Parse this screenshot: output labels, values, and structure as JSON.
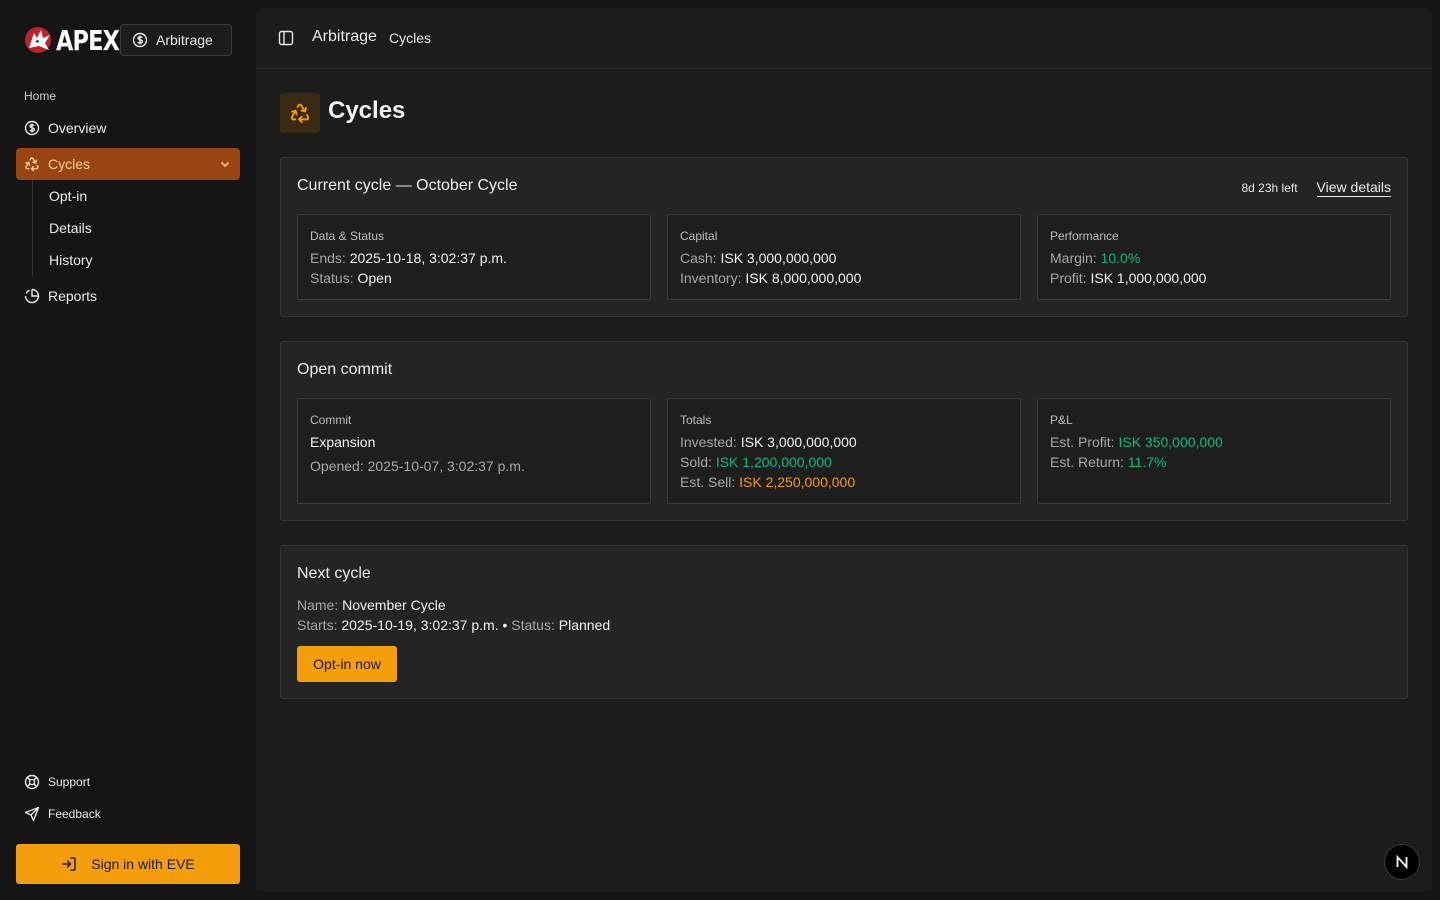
{
  "brand": {
    "logo_text": "APEX",
    "workspace_label": "Arbitrage"
  },
  "sidebar": {
    "group_label": "Home",
    "items": [
      {
        "label": "Overview",
        "icon": "dollar-circle-icon"
      },
      {
        "label": "Cycles",
        "icon": "recycle-icon",
        "active": true
      },
      {
        "label": "Reports",
        "icon": "pie-chart-icon"
      }
    ],
    "subitems": [
      {
        "label": "Opt-in"
      },
      {
        "label": "Details"
      },
      {
        "label": "History"
      }
    ],
    "footer": [
      {
        "label": "Support",
        "icon": "life-buoy-icon"
      },
      {
        "label": "Feedback",
        "icon": "send-icon"
      }
    ],
    "signin_label": "Sign in with EVE"
  },
  "header": {
    "crumb_section": "Arbitrage",
    "crumb_page": "Cycles"
  },
  "page": {
    "title": "Cycles"
  },
  "current_cycle": {
    "title": "Current cycle — October Cycle",
    "time_left": "8d 23h left",
    "view_details": "View details",
    "data_status": {
      "label": "Data & Status",
      "ends_key": "Ends:",
      "ends_val": "2025-10-18, 3:02:37 p.m.",
      "status_key": "Status:",
      "status_val": "Open"
    },
    "capital": {
      "label": "Capital",
      "cash_key": "Cash:",
      "cash_val": "ISK 3,000,000,000",
      "inv_key": "Inventory:",
      "inv_val": "ISK 8,000,000,000"
    },
    "performance": {
      "label": "Performance",
      "margin_key": "Margin:",
      "margin_val": "10.0%",
      "profit_key": "Profit:",
      "profit_val": "ISK 1,000,000,000"
    }
  },
  "open_commit": {
    "title": "Open commit",
    "commit": {
      "label": "Commit",
      "name": "Expansion",
      "opened_key": "Opened:",
      "opened_val": "2025-10-07, 3:02:37 p.m."
    },
    "totals": {
      "label": "Totals",
      "invested_key": "Invested:",
      "invested_val": "ISK 3,000,000,000",
      "sold_key": "Sold:",
      "sold_val": "ISK 1,200,000,000",
      "sell_key": "Est. Sell:",
      "sell_val": "ISK 2,250,000,000"
    },
    "pnl": {
      "label": "P&L",
      "profit_key": "Est. Profit:",
      "profit_val": "ISK 350,000,000",
      "return_key": "Est. Return:",
      "return_val": "11.7%"
    }
  },
  "next_cycle": {
    "title": "Next cycle",
    "name_key": "Name:",
    "name_val": "November Cycle",
    "starts_key": "Starts:",
    "starts_val": "2025-10-19, 3:02:37 p.m.",
    "sep": "•",
    "status_key": "Status:",
    "status_val": "Planned",
    "optin_label": "Opt-in now"
  },
  "badge": {
    "letter": "N"
  },
  "colors": {
    "accent": "#f59e0b",
    "active_nav": "#9a4410",
    "positive": "#10b981"
  }
}
